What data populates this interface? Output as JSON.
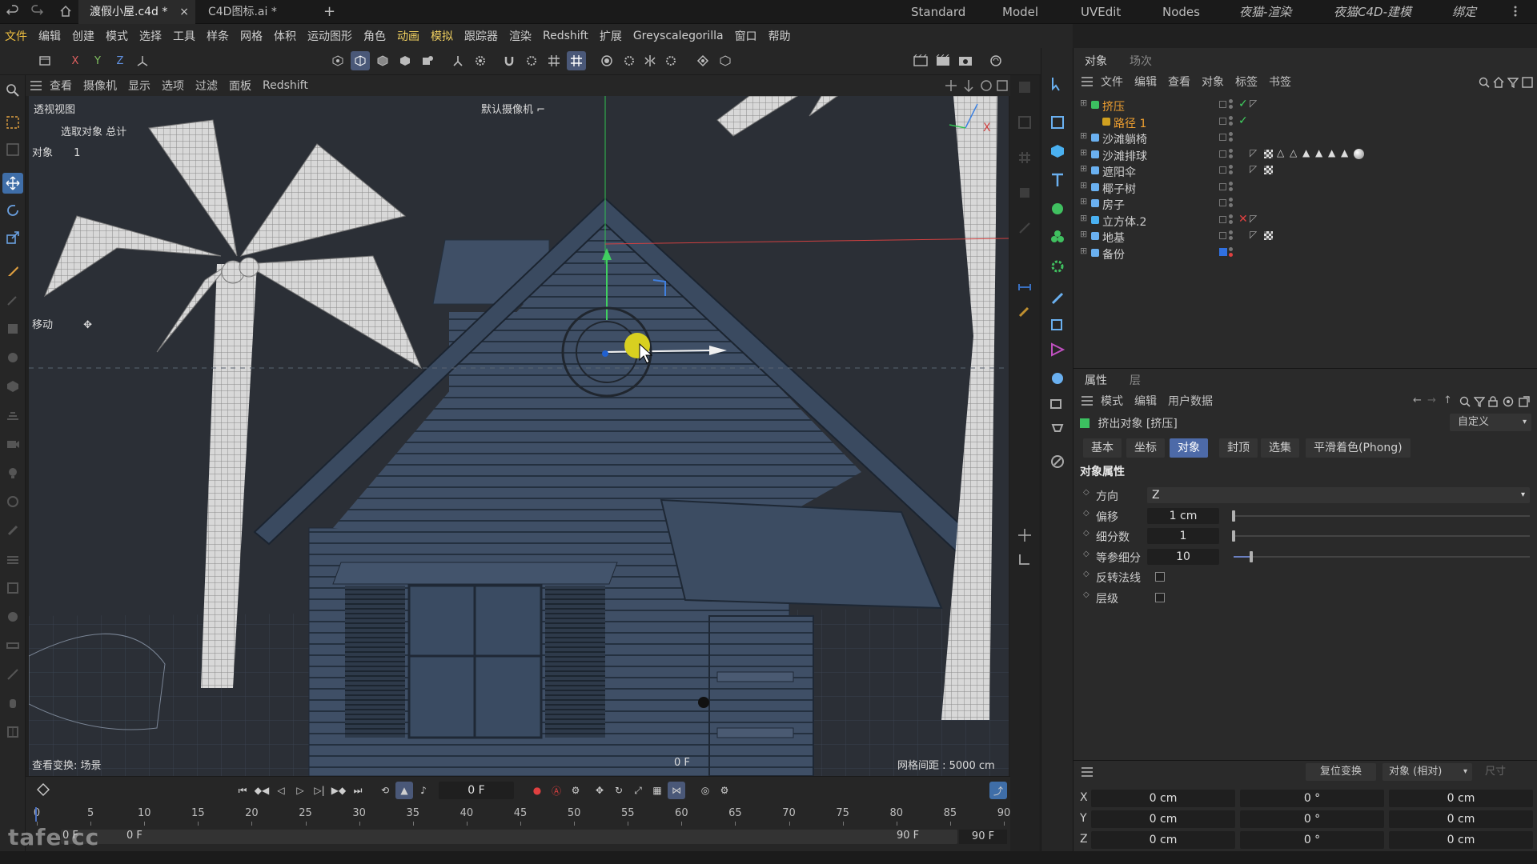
{
  "titlebar": {
    "tabs": [
      {
        "label": "渡假小屋.c4d *",
        "active": true
      },
      {
        "label": "C4D图标.ai *",
        "active": false
      }
    ],
    "add_tab": "+",
    "layouts": [
      "Standard",
      "Model",
      "UVEdit",
      "Nodes",
      "夜猫-渲染",
      "夜猫C4D-建模",
      "绑定"
    ]
  },
  "menubar": [
    "文件",
    "编辑",
    "创建",
    "模式",
    "选择",
    "工具",
    "样条",
    "网格",
    "体积",
    "运动图形",
    "角色",
    "动画",
    "模拟",
    "跟踪器",
    "渲染",
    "Redshift",
    "扩展",
    "Greyscalegorilla",
    "窗口",
    "帮助"
  ],
  "toolbar": {
    "axes": [
      "X",
      "Y",
      "Z"
    ]
  },
  "viewport": {
    "menu": [
      "查看",
      "摄像机",
      "显示",
      "选项",
      "过滤",
      "面板",
      "Redshift"
    ],
    "name": "透视视图",
    "camera": "默认摄像机",
    "selection_label": "选取对象 总计",
    "object_count_label": "对象",
    "object_count_value": "1",
    "tool_label": "移动",
    "view_transform": "查看变换: 场景",
    "frame_readout": "0 F",
    "grid_spacing": "网格间距 : 5000 cm"
  },
  "object_manager": {
    "tabs": [
      "对象",
      "场次"
    ],
    "menu": [
      "文件",
      "编辑",
      "查看",
      "对象",
      "标签",
      "书签"
    ],
    "objects": [
      {
        "name": "挤压",
        "selected": true,
        "indent": 0
      },
      {
        "name": "路径 1",
        "selected": true,
        "indent": 1
      },
      {
        "name": "沙滩躺椅",
        "selected": false,
        "indent": 0
      },
      {
        "name": "沙滩排球",
        "selected": false,
        "indent": 0
      },
      {
        "name": "遮阳伞",
        "selected": false,
        "indent": 0
      },
      {
        "name": "椰子树",
        "selected": false,
        "indent": 0
      },
      {
        "name": "房子",
        "selected": false,
        "indent": 0
      },
      {
        "name": "立方体.2",
        "selected": false,
        "indent": 0
      },
      {
        "name": "地基",
        "selected": false,
        "indent": 0
      },
      {
        "name": "备份",
        "selected": false,
        "indent": 0
      }
    ]
  },
  "attributes": {
    "tabs": [
      "属性",
      "层"
    ],
    "menu": [
      "模式",
      "编辑",
      "用户数据"
    ],
    "object_title": "挤出对象 [挤压]",
    "preset": "自定义",
    "subtabs": [
      {
        "label": "基本",
        "active": false
      },
      {
        "label": "坐标",
        "active": false
      },
      {
        "label": "对象",
        "active": true
      },
      {
        "label": "封顶",
        "active": false
      },
      {
        "label": "选集",
        "active": false
      },
      {
        "label": "平滑着色(Phong)",
        "active": false
      }
    ],
    "section": "对象属性",
    "fields": [
      {
        "label": "方向",
        "value": "Z",
        "type": "dropdown"
      },
      {
        "label": "偏移",
        "value": "1 cm",
        "type": "slider",
        "level": 0.0
      },
      {
        "label": "细分数",
        "value": "1",
        "type": "slider",
        "level": 0.0
      },
      {
        "label": "等参细分",
        "value": "10",
        "type": "slider",
        "level": 0.06
      },
      {
        "label": "反转法线",
        "value": "",
        "type": "checkbox"
      },
      {
        "label": "层级",
        "value": "",
        "type": "checkbox"
      }
    ]
  },
  "coordinates": {
    "reset_button": "复位变换",
    "mode": "对象 (相对)",
    "size_label": "尺寸",
    "rows": [
      {
        "axis": "X",
        "pos": "0 cm",
        "rot": "0 °",
        "size": "0 cm"
      },
      {
        "axis": "Y",
        "pos": "0 cm",
        "rot": "0 °",
        "size": "0 cm"
      },
      {
        "axis": "Z",
        "pos": "0 cm",
        "rot": "0 °",
        "size": "0 cm"
      }
    ]
  },
  "timeline": {
    "current_frame": "0 F",
    "ruler": [
      "0",
      "5",
      "10",
      "15",
      "20",
      "25",
      "30",
      "35",
      "40",
      "45",
      "50",
      "55",
      "60",
      "65",
      "70",
      "75",
      "80",
      "85",
      "90"
    ],
    "range_start": "0 F",
    "range_start2": "0 F",
    "range_end": "90 F",
    "range_end2": "90 F"
  },
  "watermark": "tafe.cc",
  "colors": {
    "accent": "#4d6aa8",
    "selected_text": "#f0a030",
    "viewport_bg": "#2b2f36",
    "house": "#3c4c62"
  }
}
